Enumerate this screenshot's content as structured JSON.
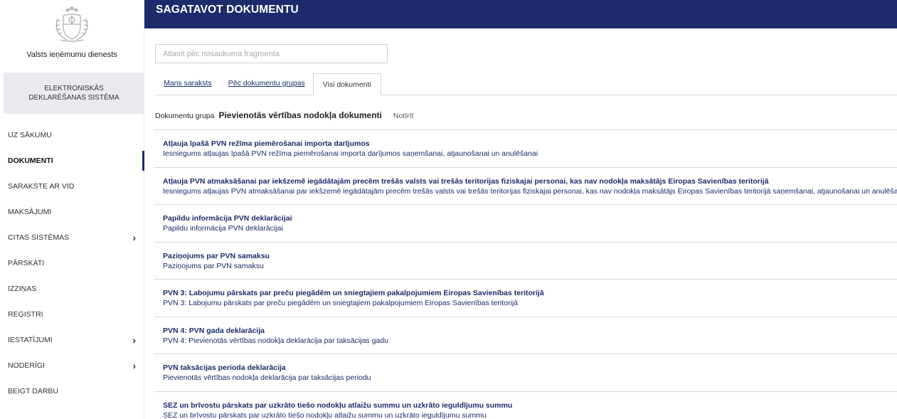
{
  "sidebar": {
    "org_name": "Valsts ieņēmumu dienests",
    "system_name": "ELEKTRONISKĀS DEKLARĒŠANAS SISTĒMA",
    "items": [
      {
        "label": "UZ SĀKUMU",
        "active": false,
        "chevron": false
      },
      {
        "label": "DOKUMENTI",
        "active": true,
        "chevron": false
      },
      {
        "label": "SARAKSTE AR VID",
        "active": false,
        "chevron": false
      },
      {
        "label": "MAKSĀJUMI",
        "active": false,
        "chevron": false
      },
      {
        "label": "CITAS SISTĒMAS",
        "active": false,
        "chevron": true
      },
      {
        "label": "PĀRSKATI",
        "active": false,
        "chevron": false
      },
      {
        "label": "IZZIŅAS",
        "active": false,
        "chevron": false
      },
      {
        "label": "REĢISTRI",
        "active": false,
        "chevron": false
      },
      {
        "label": "IESTATĪJUMI",
        "active": false,
        "chevron": true
      },
      {
        "label": "NODERĪGI",
        "active": false,
        "chevron": true
      },
      {
        "label": "BEIGT DARBU",
        "active": false,
        "chevron": false
      }
    ],
    "chevron_icon": "chevron-right-icon",
    "chevron_glyph": "›"
  },
  "header": {
    "title": "SAGATAVOT DOKUMENTU"
  },
  "search": {
    "placeholder": "Atlasīt pēc nosaukuma fragmenta",
    "value": ""
  },
  "tabs": [
    {
      "label": "Mans saraksts",
      "selected": false
    },
    {
      "label": "Pēc dokumentu grupas",
      "selected": false
    },
    {
      "label": "Visi dokumenti",
      "selected": true
    }
  ],
  "filter": {
    "label": "Dokumentu grupa",
    "value": "Pievienotās vērtības nodokļa dokumenti",
    "clear_label": "Notīrīt"
  },
  "documents": [
    {
      "title": "Atļauja īpašā PVN režīma piemērošanai importa darījumos",
      "description": "Iesniegums atļaujas īpašā PVN režīma piemērošanai importa darījumos saņemšanai, atjaunošanai un anulēšanai"
    },
    {
      "title": "Atļauja PVN atmaksāšanai par iekšzemē iegādātajām precēm trešās valsts vai trešās teritorijas fiziskajai personai, kas nav nodokļa maksātājs Eiropas Savienības teritorijā",
      "description": "Iesniegums atļaujas PVN atmaksāšanai par iekšzemē iegādātajām precēm trešās valsts vai trešās teritorijas fiziskajai personai, kas nav nodokļa maksātājs Eiropas Savienības teritorijā saņemšanai, atjaunošanai un anulēšana"
    },
    {
      "title": "Papildu informācija PVN deklarācijai",
      "description": "Papildu informācija PVN deklarācijai"
    },
    {
      "title": "Paziņojums par PVN samaksu",
      "description": "Paziņojums par PVN samaksu"
    },
    {
      "title": "PVN 3: Labojumu pārskats par preču piegādēm un sniegtajiem pakalpojumiem Eiropas Savienības teritorijā",
      "description": "PVN 3: Labojumu pārskats par preču piegādēm un sniegtajiem pakalpojumiem Eiropas Savienības teritorijā"
    },
    {
      "title": "PVN 4: PVN gada deklarācija",
      "description": "PVN 4: Pievienotās vērtības nodokļa deklarācija par taksācijas gadu"
    },
    {
      "title": "PVN taksācijas perioda deklarācija",
      "description": "Pievienotās vērtības nodokļa deklarācija par taksācijas periodu"
    },
    {
      "title": "SEZ un brīvostu pārskats par uzkrāto tiešo nodokļu atlaižu summu un uzkrāto ieguldījumu summu",
      "description": "SEZ un brīvostu pārskats par uzkrāto tiešo nodokļu atlaižu summu un uzkrāto ieguldījumu summu"
    }
  ],
  "colors": {
    "header_bg": "#1c2b6b",
    "link": "#1c2b6b",
    "active_indicator": "#1f2a6b"
  }
}
